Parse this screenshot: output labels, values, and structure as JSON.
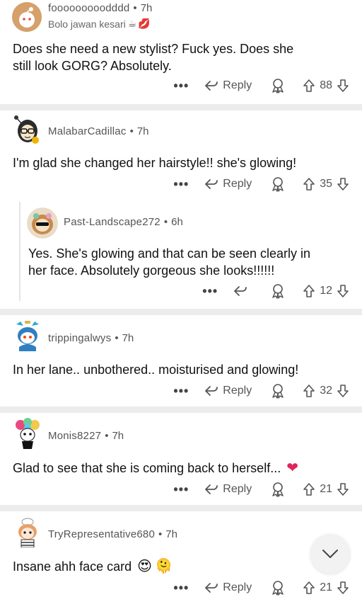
{
  "comments": [
    {
      "username": "fooooooooodddd",
      "time": "7h",
      "flair": "Bolo jawan kesari",
      "text_line1": "Does she need a new stylist? Fuck yes. Does she",
      "text_line2": "still look GORG? Absolutely.",
      "reply_label": "Reply",
      "votes": "88"
    },
    {
      "username": "MalabarCadillac",
      "time": "7h",
      "text_line1": "I'm glad she changed her hairstyle!! she's glowing!",
      "reply_label": "Reply",
      "votes": "35"
    },
    {
      "username": "Past-Landscape272",
      "time": "6h",
      "text_line1": "Yes. She's glowing and that can be seen clearly in",
      "text_line2": "her face. Absolutely gorgeous she looks!!!!!!",
      "votes": "12"
    },
    {
      "username": "trippingalwys",
      "time": "7h",
      "text_line1": "In her lane.. unbothered.. moisturised and glowing!",
      "reply_label": "Reply",
      "votes": "32"
    },
    {
      "username": "Monis8227",
      "time": "7h",
      "text_line1": "Glad to see that she is coming back to herself...",
      "reply_label": "Reply",
      "votes": "21"
    },
    {
      "username": "TryRepresentative680",
      "time": "7h",
      "text_line1": "Insane ahh face card",
      "reply_label": "Reply",
      "votes": "21"
    }
  ],
  "icons": {
    "more": "more-options-icon",
    "reply": "reply-arrow-icon",
    "award": "award-icon",
    "upvote": "upvote-arrow-icon",
    "downvote": "downvote-arrow-icon",
    "scroll": "chevron-down-icon"
  }
}
